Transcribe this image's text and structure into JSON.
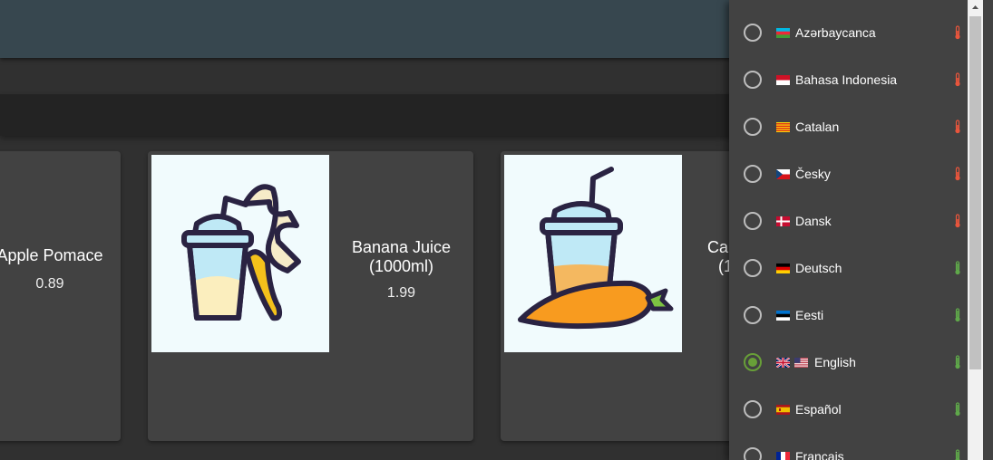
{
  "products": [
    {
      "name": "Apple Pomace",
      "price": "0.89"
    },
    {
      "name": "Banana Juice (1000ml)",
      "price": "1.99"
    },
    {
      "name_fragment": "Ca",
      "extra_fragment": "(1"
    }
  ],
  "language_menu": {
    "selected": "English",
    "items": [
      {
        "label": "Azərbaycanca",
        "flags": [
          "flag-az"
        ],
        "status": "low"
      },
      {
        "label": "Bahasa Indonesia",
        "flags": [
          "flag-id"
        ],
        "status": "low"
      },
      {
        "label": "Catalan",
        "flags": [
          "flag-ca"
        ],
        "status": "low"
      },
      {
        "label": "Česky",
        "flags": [
          "flag-cz"
        ],
        "status": "low"
      },
      {
        "label": "Dansk",
        "flags": [
          "flag-dk"
        ],
        "status": "low"
      },
      {
        "label": "Deutsch",
        "flags": [
          "flag-de"
        ],
        "status": "high"
      },
      {
        "label": "Eesti",
        "flags": [
          "flag-ee"
        ],
        "status": "high"
      },
      {
        "label": "English",
        "flags": [
          "flag-gb",
          "flag-us"
        ],
        "status": "high"
      },
      {
        "label": "Español",
        "flags": [
          "flag-es"
        ],
        "status": "high"
      },
      {
        "label": "Français",
        "flags": [
          "flag-fr"
        ],
        "status": "high"
      }
    ]
  },
  "colors": {
    "toolbar": "#37474f",
    "card": "#424242",
    "radio_selected": "#689f38",
    "thermometer_low": "#e8553c",
    "thermometer_high": "#5fa84a"
  }
}
